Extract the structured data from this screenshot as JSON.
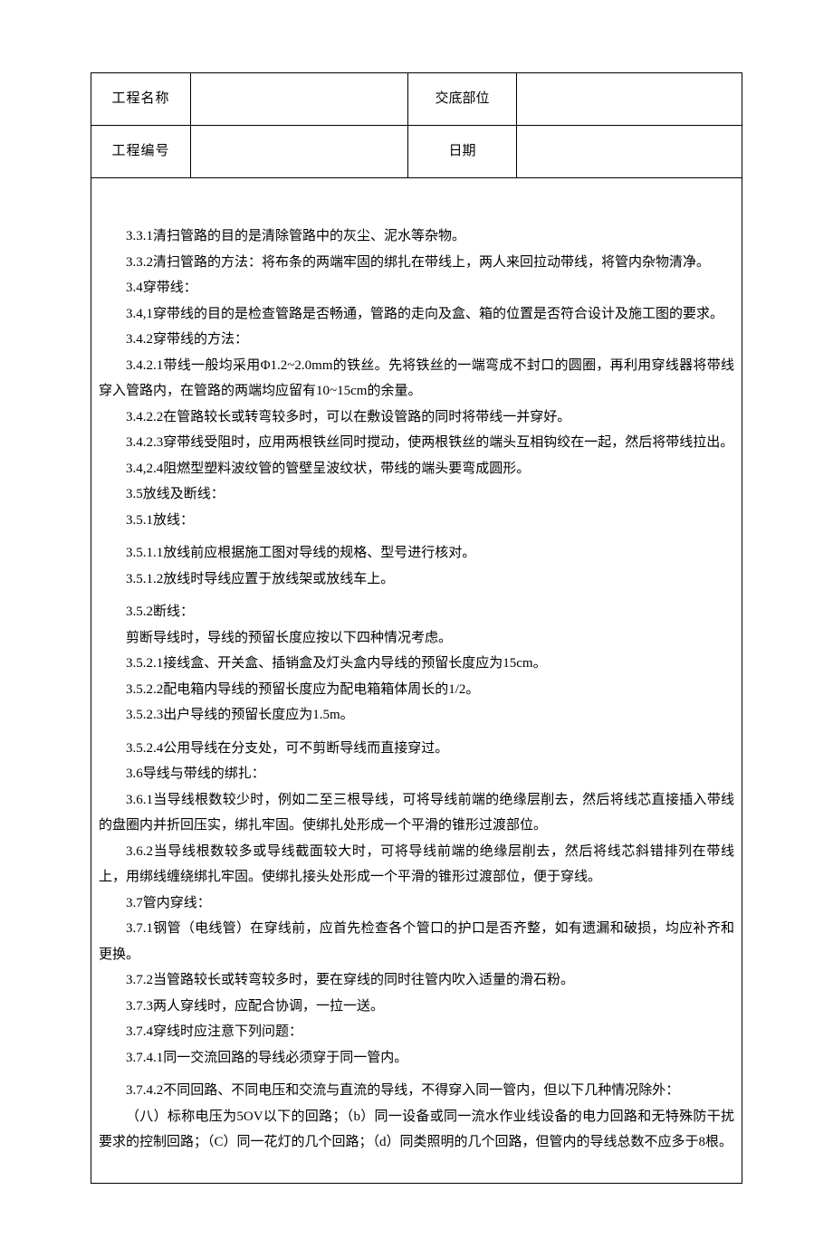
{
  "header": {
    "row1": {
      "label1": "工程名称",
      "val1": "",
      "label2": "交底部位",
      "val2": ""
    },
    "row2": {
      "label1": "工程编号",
      "val1": "",
      "label2": "日期",
      "val2": ""
    }
  },
  "content": {
    "p01": "3.3.1清扫管路的目的是清除管路中的灰尘、泥水等杂物。",
    "p02": "3.3.2清扫管路的方法：将布条的两端牢固的绑扎在带线上，两人来回拉动带线，将管内杂物清净。",
    "p03": "3.4穿带线：",
    "p04": "3.4,1穿带线的目的是检查管路是否畅通，管路的走向及盒、箱的位置是否符合设计及施工图的要求。",
    "p05": "3.4.2穿带线的方法：",
    "p06": "3.4.2.1带线一般均采用Φ1.2~2.0mm的铁丝。先将铁丝的一端弯成不封口的圆圈，再利用穿线器将带线穿入管路内，在管路的两端均应留有10~15cm的余量。",
    "p07": "3.4.2.2在管路较长或转弯较多时，可以在敷设管路的同时将带线一并穿好。",
    "p08": "3.4.2.3穿带线受阻时，应用两根铁丝同时搅动，使两根铁丝的端头互相钩绞在一起，然后将带线拉出。",
    "p09": "3.4,2.4阻燃型塑料波纹管的管壁呈波纹状，带线的端头要弯成圆形。",
    "p10": "3.5放线及断线：",
    "p11": "3.5.1放线：",
    "p12": "3.5.1.1放线前应根据施工图对导线的规格、型号进行核对。",
    "p13": "3.5.1.2放线时导线应置于放线架或放线车上。",
    "p14": "3.5.2断线：",
    "p15": "剪断导线时，导线的预留长度应按以下四种情况考虑。",
    "p16": "3.5.2.1接线盒、开关盒、插销盒及灯头盒内导线的预留长度应为15cm。",
    "p17": "3.5.2.2配电箱内导线的预留长度应为配电箱箱体周长的1/2。",
    "p18": "3.5.2.3出户导线的预留长度应为1.5m。",
    "p19": "3.5.2.4公用导线在分支处，可不剪断导线而直接穿过。",
    "p20": "3.6导线与带线的绑扎：",
    "p21": "3.6.1当导线根数较少时，例如二至三根导线，可将导线前端的绝缘层削去，然后将线芯直接插入带线的盘圈内并折回压实，绑扎牢固。使绑扎处形成一个平滑的锥形过渡部位。",
    "p22": "3.6.2当导线根数较多或导线截面较大时，可将导线前端的绝缘层削去，然后将线芯斜错排列在带线上，用绑线缠绕绑扎牢固。使绑扎接头处形成一个平滑的锥形过渡部位，便于穿线。",
    "p23": "3.7管内穿线：",
    "p24": "3.7.1钢管（电线管）在穿线前，应首先检查各个管口的护口是否齐整，如有遗漏和破损，均应补齐和更换。",
    "p25": "3.7.2当管路较长或转弯较多时，要在穿线的同时往管内吹入适量的滑石粉。",
    "p26": "3.7.3两人穿线时，应配合协调，一拉一送。",
    "p27": "3.7.4穿线时应注意下列问题：",
    "p28": "3.7.4.1同一交流回路的导线必须穿于同一管内。",
    "p29": "3.7.4.2不同回路、不同电压和交流与直流的导线，不得穿入同一管内，但以下几种情况除外：",
    "p30": "（八）标称电压为5OV以下的回路；（b）同一设备或同一流水作业线设备的电力回路和无特殊防干扰要求的控制回路；（C）同一花灯的几个回路；（d）同类照明的几个回路，但管内的导线总数不应多于8根。"
  }
}
